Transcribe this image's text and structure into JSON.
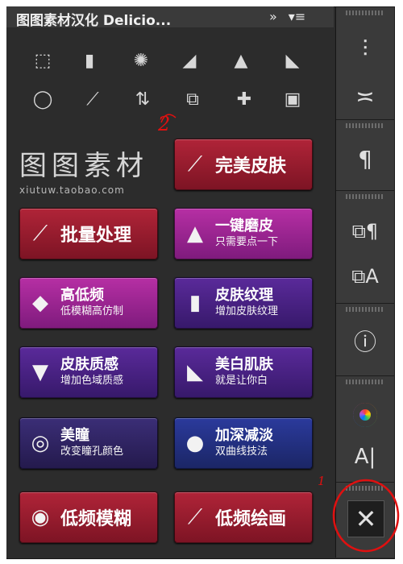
{
  "titlebar": {
    "title": "图图素材汉化 Delicio...",
    "collapse_icon": "double-chevron-right-icon",
    "menu_icon": "panel-menu-icon"
  },
  "tools": [
    {
      "name": "select-frame-icon",
      "glyph": "⬚"
    },
    {
      "name": "gradient-icon",
      "glyph": "▮"
    },
    {
      "name": "splatter-icon",
      "glyph": "✺"
    },
    {
      "name": "histogram-1-icon",
      "glyph": "◢"
    },
    {
      "name": "histogram-2-icon",
      "glyph": "▲"
    },
    {
      "name": "histogram-3-icon",
      "glyph": "◣"
    },
    {
      "name": "lasso-icon",
      "glyph": "◯"
    },
    {
      "name": "brush-icon",
      "glyph": "⟋"
    },
    {
      "name": "swap-arrows-icon",
      "glyph": "⇅"
    },
    {
      "name": "layers-copy-icon",
      "glyph": "⧉"
    },
    {
      "name": "bandage-icon",
      "glyph": "✚"
    },
    {
      "name": "chip-icon",
      "glyph": "▣"
    }
  ],
  "logo": {
    "big": "图图素材",
    "small": "xiutuw.taobao.com"
  },
  "buttons": {
    "perfect_skin": "完美皮肤",
    "batch": "批量处理",
    "one_click": {
      "l1": "一键磨皮",
      "l2": "只需要点一下"
    },
    "high_low": {
      "l1": "高低频",
      "l2": "低模糊高仿制"
    },
    "texture": {
      "l1": "皮肤纹理",
      "l2": "增加皮肤纹理"
    },
    "quality": {
      "l1": "皮肤质感",
      "l2": "增加色域质感"
    },
    "whitening": {
      "l1": "美白肌肤",
      "l2": "就是让你白"
    },
    "pupil": {
      "l1": "美瞳",
      "l2": "改变瞳孔颜色"
    },
    "deepen": {
      "l1": "加深减淡",
      "l2": "双曲线技法"
    },
    "lowfreq_blur": "低频模糊",
    "lowfreq_paint": "低频绘画"
  },
  "annotations": {
    "two": "2",
    "one": "1"
  },
  "colors": {
    "red": "#9b1c2e",
    "magenta": "#9c2590",
    "purple": "#4a2384",
    "navy": "#2f245f",
    "blue": "#23308a",
    "annotation": "#e01010"
  }
}
